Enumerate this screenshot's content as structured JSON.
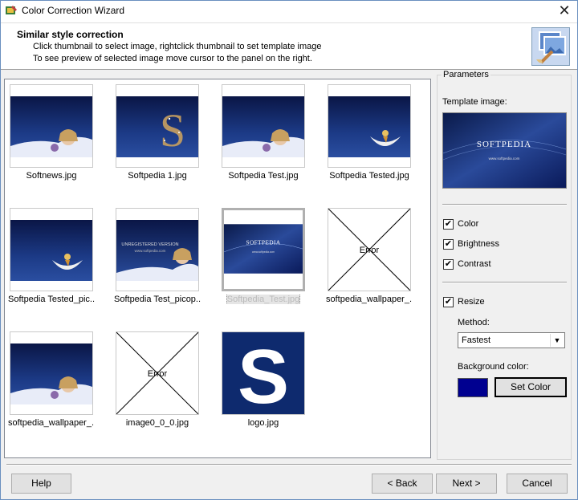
{
  "window": {
    "title": "Color Correction Wizard",
    "close_glyph": "✕"
  },
  "header": {
    "title": "Similar style correction",
    "line1": "Click thumbnail to select image, rightclick thumbnail to set template image",
    "line2": "To see preview of selected image move cursor to the panel on the right."
  },
  "thumbnails": [
    {
      "name": "Softnews.jpg",
      "kind": "photo"
    },
    {
      "name": "Softpedia 1.jpg",
      "kind": "logo-s"
    },
    {
      "name": "Softpedia Test.jpg",
      "kind": "photo"
    },
    {
      "name": "Softpedia Tested.jpg",
      "kind": "moon"
    },
    {
      "name": "Softpedia Tested_pic...",
      "kind": "moon"
    },
    {
      "name": "Softpedia Test_picop...",
      "kind": "unreg"
    },
    {
      "name": "Softpedia_Test.jpg",
      "kind": "banner",
      "selected": true
    },
    {
      "name": "softpedia_wallpaper_...",
      "kind": "error",
      "error_text": "Error"
    },
    {
      "name": "softpedia_wallpaper_...",
      "kind": "photo"
    },
    {
      "name": "image0_0_0.jpg",
      "kind": "error",
      "error_text": "Error"
    },
    {
      "name": "logo.jpg",
      "kind": "big-s"
    }
  ],
  "thumb_text": {
    "unreg_line1": "UNREGISTERED VERSION",
    "unreg_line2": "www.softpedia.com",
    "banner_text": "SOFTPEDIA",
    "banner_sub": "www.softpedia.com"
  },
  "parameters": {
    "title": "Parameters",
    "template_label": "Template image:",
    "template_text": "SOFTPEDIA",
    "template_sub": "www.softpedia.com",
    "color": {
      "label": "Color",
      "checked": true
    },
    "brightness": {
      "label": "Brightness",
      "checked": true
    },
    "contrast": {
      "label": "Contrast",
      "checked": true
    },
    "resize": {
      "label": "Resize",
      "checked": true
    },
    "method_label": "Method:",
    "method_value": "Fastest",
    "bg_label": "Background color:",
    "bg_color": "#000090",
    "set_color_label": "Set Color"
  },
  "buttons": {
    "help": "Help",
    "back": "< Back",
    "next": "Next >",
    "cancel": "Cancel"
  }
}
